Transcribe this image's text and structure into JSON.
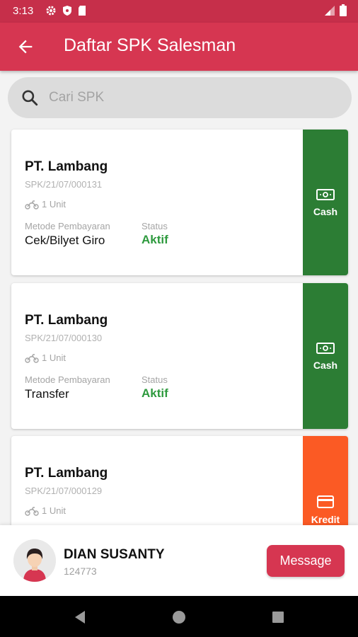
{
  "status_bar": {
    "time": "3:13"
  },
  "app_bar": {
    "title": "Daftar SPK Salesman"
  },
  "search": {
    "placeholder": "Cari SPK",
    "value": ""
  },
  "cards": [
    {
      "company": "PT. Lambang",
      "code": "SPK/21/07/000131",
      "units": "1 Unit",
      "method_label": "Metode Pembayaran",
      "method": "Cek/Bilyet Giro",
      "status_label": "Status",
      "status": "Aktif",
      "payment_type": "Cash",
      "payment_icon": "cash-icon"
    },
    {
      "company": "PT. Lambang",
      "code": "SPK/21/07/000130",
      "units": "1 Unit",
      "method_label": "Metode Pembayaran",
      "method": "Transfer",
      "status_label": "Status",
      "status": "Aktif",
      "payment_type": "Cash",
      "payment_icon": "cash-icon"
    },
    {
      "company": "PT. Lambang",
      "code": "SPK/21/07/000129",
      "units": "1 Unit",
      "payment_type": "Kredit",
      "payment_icon": "credit-card-icon"
    }
  ],
  "user": {
    "name": "DIAN SUSANTY",
    "id": "124773",
    "message_label": "Message"
  },
  "colors": {
    "primary": "#d63651",
    "status_bar": "#c62f4a",
    "cash": "#2c7d34",
    "kredit": "#fb5a24",
    "active": "#2e9a3e"
  }
}
